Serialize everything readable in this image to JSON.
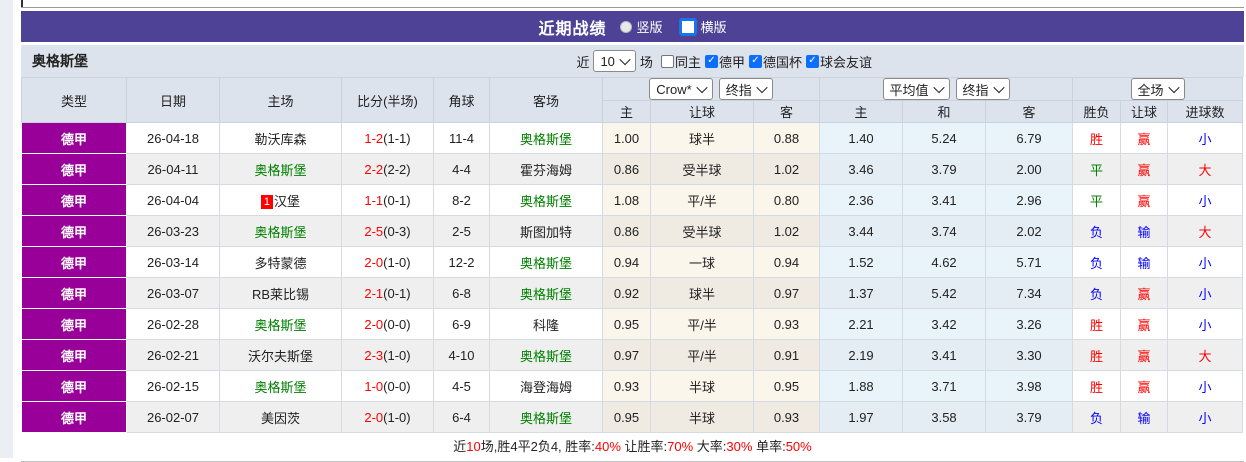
{
  "banner": {
    "title": "近期战绩",
    "radios": [
      {
        "label": "竖版",
        "selected": false
      },
      {
        "label": "横版",
        "selected": true
      }
    ]
  },
  "filter": {
    "team": "奥格斯堡",
    "near_label": "近",
    "games_value": "10",
    "games_suffix": "场",
    "checkboxes": [
      {
        "label": "同主",
        "checked": false
      },
      {
        "label": "德甲",
        "checked": true
      },
      {
        "label": "德国杯",
        "checked": true
      },
      {
        "label": "球会友谊",
        "checked": true
      }
    ]
  },
  "table": {
    "group_selects": {
      "asian": [
        {
          "value": "Crow*"
        },
        {
          "value": "终指"
        }
      ],
      "euro": [
        {
          "value": "平均值"
        },
        {
          "value": "终指"
        }
      ],
      "result": [
        {
          "value": "全场"
        }
      ]
    },
    "columns": [
      "类型",
      "日期",
      "主场",
      "比分(半场)",
      "角球",
      "客场"
    ],
    "subcolumns": [
      "主",
      "让球",
      "客",
      "主",
      "和",
      "客",
      "胜负",
      "让球",
      "进球数"
    ],
    "rows": [
      {
        "league": "德甲",
        "date": "26-04-18",
        "home": "勒沃库森",
        "home_green": false,
        "home_badge": "",
        "score": "1-2",
        "half": "(1-1)",
        "corner": "11-4",
        "away": "奥格斯堡",
        "away_green": true,
        "asian": [
          "1.00",
          "球半",
          "0.88"
        ],
        "euro": [
          "1.40",
          "5.24",
          "6.79"
        ],
        "results": [
          {
            "t": "胜",
            "c": "red"
          },
          {
            "t": "赢",
            "c": "red"
          },
          {
            "t": "小",
            "c": "blue"
          }
        ]
      },
      {
        "league": "德甲",
        "date": "26-04-11",
        "home": "奥格斯堡",
        "home_green": true,
        "home_badge": "",
        "score": "2-2",
        "half": "(2-2)",
        "corner": "4-4",
        "away": "霍芬海姆",
        "away_green": false,
        "asian": [
          "0.86",
          "受半球",
          "1.02"
        ],
        "euro": [
          "3.46",
          "3.79",
          "2.00"
        ],
        "results": [
          {
            "t": "平",
            "c": "green"
          },
          {
            "t": "赢",
            "c": "red"
          },
          {
            "t": "大",
            "c": "red"
          }
        ]
      },
      {
        "league": "德甲",
        "date": "26-04-04",
        "home": "汉堡",
        "home_green": false,
        "home_badge": "1",
        "score": "1-1",
        "half": "(0-1)",
        "corner": "8-2",
        "away": "奥格斯堡",
        "away_green": true,
        "asian": [
          "1.08",
          "平/半",
          "0.80"
        ],
        "euro": [
          "2.36",
          "3.41",
          "2.96"
        ],
        "results": [
          {
            "t": "平",
            "c": "green"
          },
          {
            "t": "赢",
            "c": "red"
          },
          {
            "t": "小",
            "c": "blue"
          }
        ]
      },
      {
        "league": "德甲",
        "date": "26-03-23",
        "home": "奥格斯堡",
        "home_green": true,
        "home_badge": "",
        "score": "2-5",
        "half": "(0-3)",
        "corner": "2-5",
        "away": "斯图加特",
        "away_green": false,
        "asian": [
          "0.86",
          "受半球",
          "1.02"
        ],
        "euro": [
          "3.44",
          "3.74",
          "2.02"
        ],
        "results": [
          {
            "t": "负",
            "c": "blue"
          },
          {
            "t": "输",
            "c": "blue"
          },
          {
            "t": "大",
            "c": "red"
          }
        ]
      },
      {
        "league": "德甲",
        "date": "26-03-14",
        "home": "多特蒙德",
        "home_green": false,
        "home_badge": "",
        "score": "2-0",
        "half": "(1-0)",
        "corner": "12-2",
        "away": "奥格斯堡",
        "away_green": true,
        "asian": [
          "0.94",
          "一球",
          "0.94"
        ],
        "euro": [
          "1.52",
          "4.62",
          "5.71"
        ],
        "results": [
          {
            "t": "负",
            "c": "blue"
          },
          {
            "t": "输",
            "c": "blue"
          },
          {
            "t": "小",
            "c": "blue"
          }
        ]
      },
      {
        "league": "德甲",
        "date": "26-03-07",
        "home": "RB莱比锡",
        "home_green": false,
        "home_badge": "",
        "score": "2-1",
        "half": "(0-1)",
        "corner": "6-8",
        "away": "奥格斯堡",
        "away_green": true,
        "asian": [
          "0.92",
          "球半",
          "0.97"
        ],
        "euro": [
          "1.37",
          "5.42",
          "7.34"
        ],
        "results": [
          {
            "t": "负",
            "c": "blue"
          },
          {
            "t": "赢",
            "c": "red"
          },
          {
            "t": "小",
            "c": "blue"
          }
        ]
      },
      {
        "league": "德甲",
        "date": "26-02-28",
        "home": "奥格斯堡",
        "home_green": true,
        "home_badge": "",
        "score": "2-0",
        "half": "(0-0)",
        "corner": "6-9",
        "away": "科隆",
        "away_green": false,
        "asian": [
          "0.95",
          "平/半",
          "0.93"
        ],
        "euro": [
          "2.21",
          "3.42",
          "3.26"
        ],
        "results": [
          {
            "t": "胜",
            "c": "red"
          },
          {
            "t": "赢",
            "c": "red"
          },
          {
            "t": "小",
            "c": "blue"
          }
        ]
      },
      {
        "league": "德甲",
        "date": "26-02-21",
        "home": "沃尔夫斯堡",
        "home_green": false,
        "home_badge": "",
        "score": "2-3",
        "half": "(1-0)",
        "corner": "4-10",
        "away": "奥格斯堡",
        "away_green": true,
        "asian": [
          "0.97",
          "平/半",
          "0.91"
        ],
        "euro": [
          "2.19",
          "3.41",
          "3.30"
        ],
        "results": [
          {
            "t": "胜",
            "c": "red"
          },
          {
            "t": "赢",
            "c": "red"
          },
          {
            "t": "大",
            "c": "red"
          }
        ]
      },
      {
        "league": "德甲",
        "date": "26-02-15",
        "home": "奥格斯堡",
        "home_green": true,
        "home_badge": "",
        "score": "1-0",
        "half": "(0-0)",
        "corner": "4-5",
        "away": "海登海姆",
        "away_green": false,
        "asian": [
          "0.93",
          "半球",
          "0.95"
        ],
        "euro": [
          "1.88",
          "3.71",
          "3.98"
        ],
        "results": [
          {
            "t": "胜",
            "c": "red"
          },
          {
            "t": "赢",
            "c": "red"
          },
          {
            "t": "小",
            "c": "blue"
          }
        ]
      },
      {
        "league": "德甲",
        "date": "26-02-07",
        "home": "美因茨",
        "home_green": false,
        "home_badge": "",
        "score": "2-0",
        "half": "(1-0)",
        "corner": "6-4",
        "away": "奥格斯堡",
        "away_green": true,
        "asian": [
          "0.95",
          "半球",
          "0.93"
        ],
        "euro": [
          "1.97",
          "3.58",
          "3.79"
        ],
        "results": [
          {
            "t": "负",
            "c": "blue"
          },
          {
            "t": "输",
            "c": "blue"
          },
          {
            "t": "小",
            "c": "blue"
          }
        ]
      }
    ]
  },
  "footer": {
    "segments": [
      {
        "t": "近",
        "c": "black"
      },
      {
        "t": "10",
        "c": "red"
      },
      {
        "t": "场,胜4平2负4, 胜率:",
        "c": "black"
      },
      {
        "t": "40%",
        "c": "red"
      },
      {
        "t": " 让胜率:",
        "c": "black"
      },
      {
        "t": "70%",
        "c": "red"
      },
      {
        "t": " 大率:",
        "c": "black"
      },
      {
        "t": "30%",
        "c": "red"
      },
      {
        "t": " 单率:",
        "c": "black"
      },
      {
        "t": "50%",
        "c": "red"
      }
    ]
  },
  "colors": {
    "banner_purple": "#4e4296",
    "league_magenta": "#990099",
    "win_red": "#ff0000",
    "draw_green": "#008000",
    "lose_blue": "#0000ff",
    "asian_cell_tint": "#fbf6ec",
    "euro_cell_tint": "#e9f4fa",
    "header_gray": "#dde3ed"
  }
}
